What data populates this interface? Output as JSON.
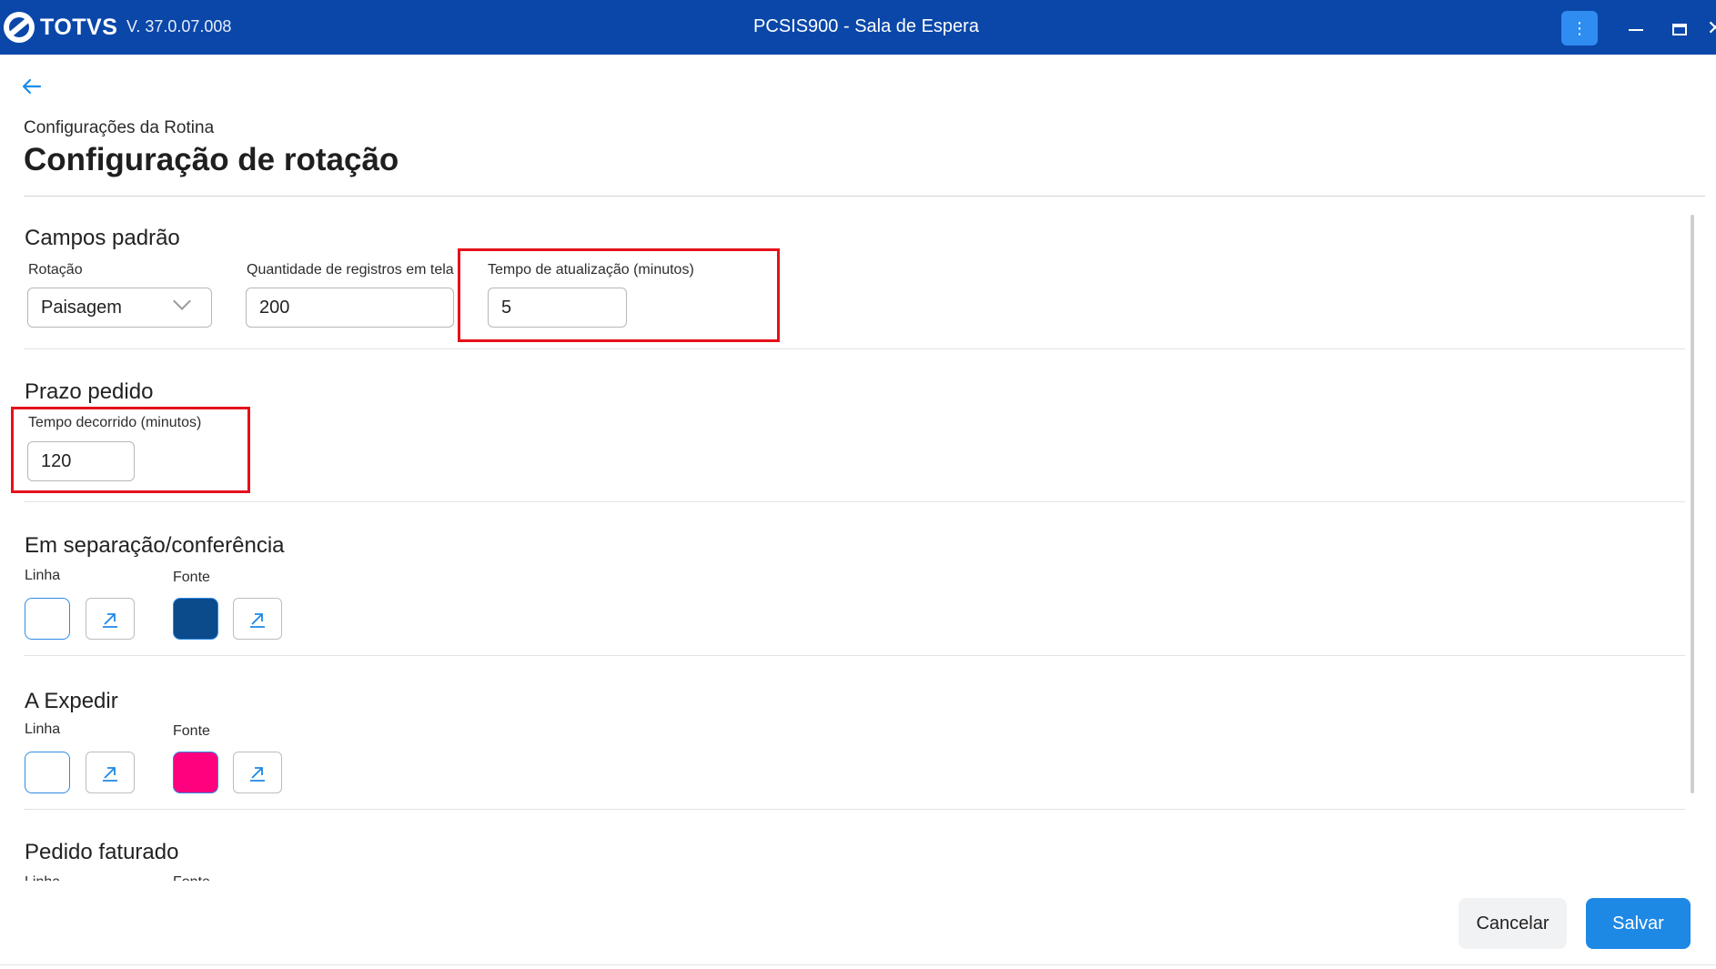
{
  "titlebar": {
    "logo_text": "TOTVS",
    "version": "V. 37.0.07.008",
    "window_title": "PCSIS900 - Sala de Espera",
    "kebab_icon": "more-vertical-icon",
    "color": "#0a47a9"
  },
  "header": {
    "breadcrumb": "Configurações da Rotina",
    "title": "Configuração de rotação"
  },
  "sections": {
    "campos_padrao": {
      "title": "Campos padrão",
      "rotacao": {
        "label": "Rotação",
        "value": "Paisagem"
      },
      "quantidade": {
        "label": "Quantidade de registros em tela",
        "value": "200"
      },
      "tempo_atualizacao": {
        "label": "Tempo de atualização (minutos)",
        "value": "5"
      }
    },
    "prazo_pedido": {
      "title": "Prazo pedido",
      "tempo_decorrido": {
        "label": "Tempo decorrido (minutos)",
        "value": "120"
      }
    },
    "em_separacao": {
      "title": "Em separação/conferência",
      "linha_label": "Linha",
      "fonte_label": "Fonte",
      "linha_color": "#ffffff",
      "fonte_color": "#0b4a8b"
    },
    "a_expedir": {
      "title": "A Expedir",
      "linha_label": "Linha",
      "fonte_label": "Fonte",
      "linha_color": "#ffffff",
      "fonte_color": "#ff007f"
    },
    "pedido_faturado": {
      "title": "Pedido faturado",
      "linha_label": "Linha",
      "fonte_label": "Fonte"
    }
  },
  "footer": {
    "cancel_label": "Cancelar",
    "save_label": "Salvar"
  }
}
